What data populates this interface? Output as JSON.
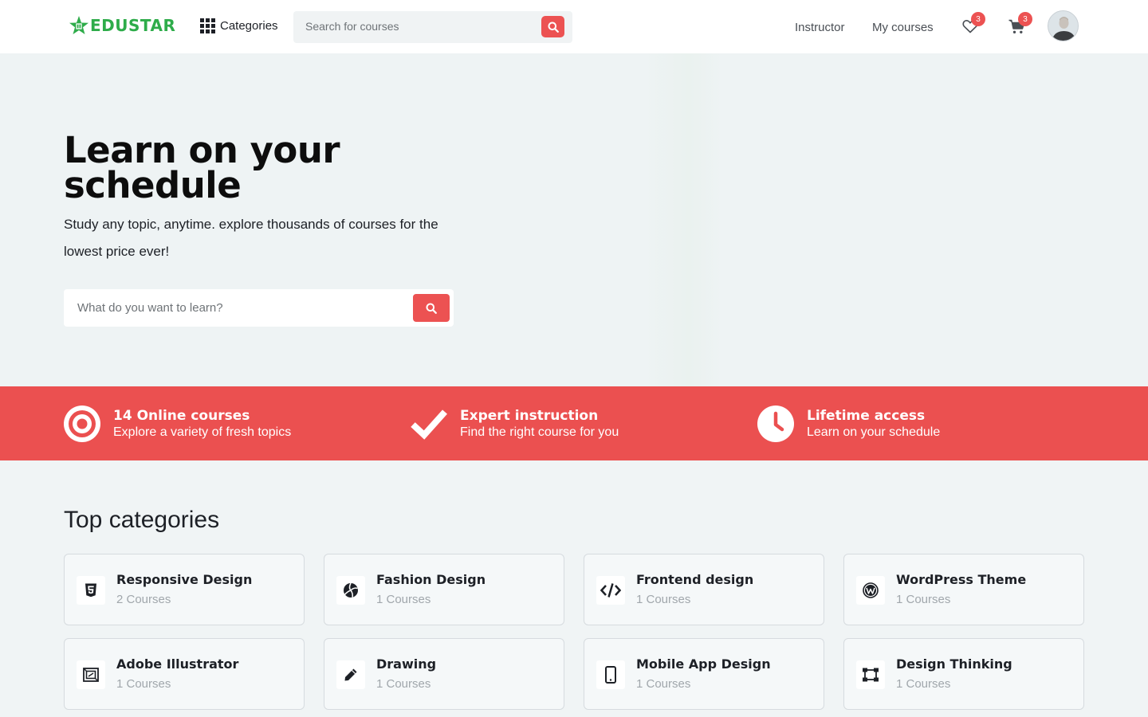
{
  "header": {
    "logo_text": "EDUSTAR",
    "categories_label": "Categories",
    "search_placeholder": "Search for courses",
    "nav": {
      "instructor": "Instructor",
      "my_courses": "My courses"
    },
    "wishlist_count": "3",
    "cart_count": "3"
  },
  "hero": {
    "title": "Learn on your schedule",
    "subtitle": "Study any topic, anytime. explore thousands of courses for the lowest price ever!",
    "search_placeholder": "What do you want to learn?"
  },
  "features": [
    {
      "title": "14 Online courses",
      "description": "Explore a variety of fresh topics",
      "icon": "target-icon"
    },
    {
      "title": "Expert instruction",
      "description": "Find the right course for you",
      "icon": "check-icon"
    },
    {
      "title": "Lifetime access",
      "description": "Learn on your schedule",
      "icon": "clock-icon"
    }
  ],
  "top_categories": {
    "title": "Top categories",
    "items": [
      {
        "name": "Responsive Design",
        "count": "2 Courses",
        "icon": "html5-icon"
      },
      {
        "name": "Fashion Design",
        "count": "1 Courses",
        "icon": "volleyball-icon"
      },
      {
        "name": "Frontend design",
        "count": "1 Courses",
        "icon": "code-icon"
      },
      {
        "name": "WordPress Theme",
        "count": "1 Courses",
        "icon": "wordpress-icon"
      },
      {
        "name": "Adobe Illustrator",
        "count": "1 Courses",
        "icon": "frame-icon"
      },
      {
        "name": "Drawing",
        "count": "1 Courses",
        "icon": "pencil-icon"
      },
      {
        "name": "Mobile App Design",
        "count": "1 Courses",
        "icon": "mobile-icon"
      },
      {
        "name": "Design Thinking",
        "count": "1 Courses",
        "icon": "vector-square-icon"
      }
    ]
  },
  "colors": {
    "brand_green": "#2eac4a",
    "accent_red": "#ec5252",
    "band_red": "#eb5050"
  }
}
